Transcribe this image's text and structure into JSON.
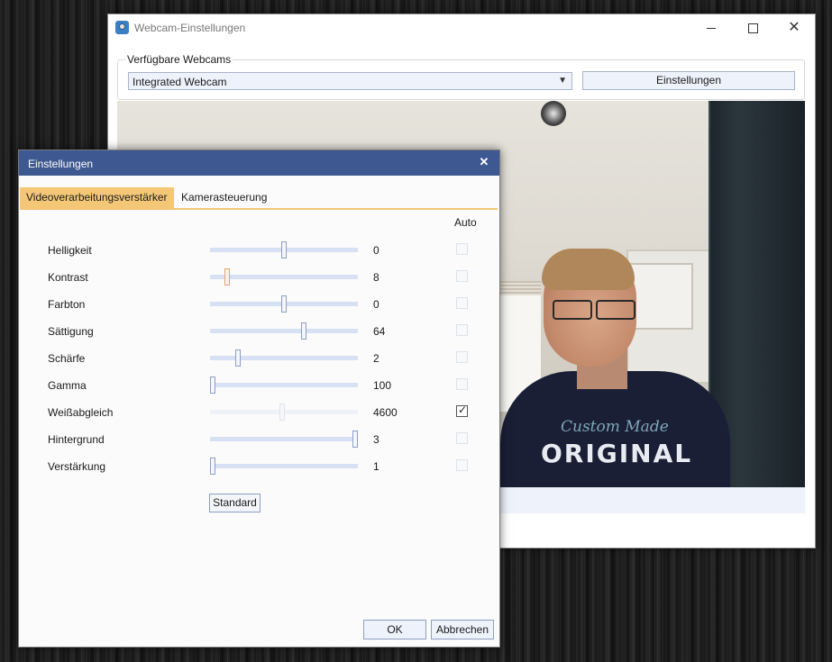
{
  "main_window": {
    "title": "Webcam-Einstellungen",
    "controls": {
      "minimize": "",
      "maximize": "",
      "close": "✕"
    },
    "webcam_group": {
      "label": "Verfügbare Webcams",
      "selected_webcam": "Integrated Webcam",
      "settings_button": "Einstellungen"
    },
    "preview": {
      "shirt_text": "ORIGINAL",
      "shirt_script": "Custom Made"
    }
  },
  "dialog": {
    "title": "Einstellungen",
    "close": "✕",
    "tabs": [
      {
        "label": "Videoverarbeitungsverstärker",
        "active": true
      },
      {
        "label": "Kamerasteuerung",
        "active": false
      }
    ],
    "auto_header": "Auto",
    "rows": [
      {
        "label": "Helligkeit",
        "value": "0",
        "level": 0.5,
        "auto": false,
        "enabled": true
      },
      {
        "label": "Kontrast",
        "value": "8",
        "level": 0.1,
        "auto": false,
        "enabled": true
      },
      {
        "label": "Farbton",
        "value": "0",
        "level": 0.5,
        "auto": false,
        "enabled": true
      },
      {
        "label": "Sättigung",
        "value": "64",
        "level": 0.64,
        "auto": false,
        "enabled": true
      },
      {
        "label": "Schärfe",
        "value": "2",
        "level": 0.18,
        "auto": false,
        "enabled": true
      },
      {
        "label": "Gamma",
        "value": "100",
        "level": 0.0,
        "auto": false,
        "enabled": true
      },
      {
        "label": "Weißabgleich",
        "value": "4600",
        "level": 0.49,
        "auto": true,
        "enabled": false
      },
      {
        "label": "Hintergrund",
        "value": "3",
        "level": 1.0,
        "auto": false,
        "enabled": true
      },
      {
        "label": "Verstärkung",
        "value": "1",
        "level": 0.0,
        "auto": false,
        "enabled": true
      }
    ],
    "standard_button": "Standard",
    "ok_button": "OK",
    "cancel_button": "Abbrechen"
  }
}
